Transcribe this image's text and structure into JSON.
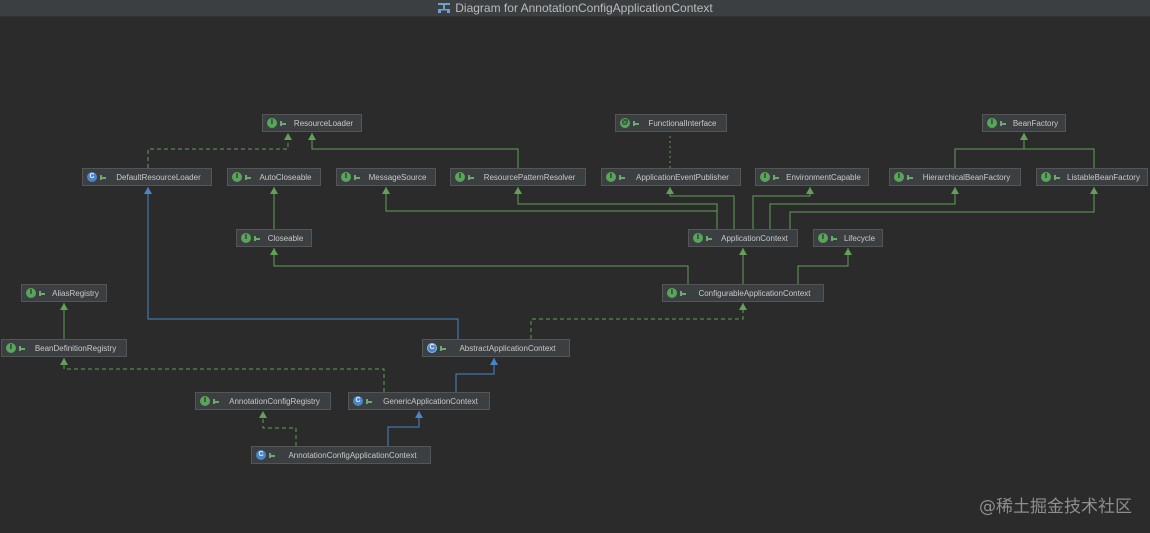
{
  "title": "Diagram for AnnotationConfigApplicationContext",
  "colors": {
    "background": "#2b2b2b",
    "node_fill": "#3c3f41",
    "interface_icon": "#58a55c",
    "class_icon": "#4a86c7",
    "extends_edge": "#4a86c7",
    "implements_edge": "#62a157"
  },
  "nodes": [
    {
      "id": "ResourceLoader",
      "label": "ResourceLoader",
      "kind": "interface"
    },
    {
      "id": "FunctionalInterface",
      "label": "FunctionalInterface",
      "kind": "annotation"
    },
    {
      "id": "BeanFactory",
      "label": "BeanFactory",
      "kind": "interface"
    },
    {
      "id": "DefaultResourceLoader",
      "label": "DefaultResourceLoader",
      "kind": "class"
    },
    {
      "id": "AutoCloseable",
      "label": "AutoCloseable",
      "kind": "interface"
    },
    {
      "id": "MessageSource",
      "label": "MessageSource",
      "kind": "interface"
    },
    {
      "id": "ResourcePatternResolver",
      "label": "ResourcePatternResolver",
      "kind": "interface"
    },
    {
      "id": "ApplicationEventPublisher",
      "label": "ApplicationEventPublisher",
      "kind": "interface"
    },
    {
      "id": "EnvironmentCapable",
      "label": "EnvironmentCapable",
      "kind": "interface"
    },
    {
      "id": "HierarchicalBeanFactory",
      "label": "HierarchicalBeanFactory",
      "kind": "interface"
    },
    {
      "id": "ListableBeanFactory",
      "label": "ListableBeanFactory",
      "kind": "interface"
    },
    {
      "id": "Closeable",
      "label": "Closeable",
      "kind": "interface"
    },
    {
      "id": "ApplicationContext",
      "label": "ApplicationContext",
      "kind": "interface"
    },
    {
      "id": "Lifecycle",
      "label": "Lifecycle",
      "kind": "interface"
    },
    {
      "id": "AliasRegistry",
      "label": "AliasRegistry",
      "kind": "interface"
    },
    {
      "id": "ConfigurableApplicationContext",
      "label": "ConfigurableApplicationContext",
      "kind": "interface"
    },
    {
      "id": "BeanDefinitionRegistry",
      "label": "BeanDefinitionRegistry",
      "kind": "interface"
    },
    {
      "id": "AbstractApplicationContext",
      "label": "AbstractApplicationContext",
      "kind": "abstract"
    },
    {
      "id": "AnnotationConfigRegistry",
      "label": "AnnotationConfigRegistry",
      "kind": "interface"
    },
    {
      "id": "GenericApplicationContext",
      "label": "GenericApplicationContext",
      "kind": "class"
    },
    {
      "id": "AnnotationConfigApplicationContext",
      "label": "AnnotationConfigApplicationContext",
      "kind": "class"
    }
  ],
  "edges": [
    {
      "from": "DefaultResourceLoader",
      "to": "ResourceLoader",
      "type": "implements"
    },
    {
      "from": "ResourcePatternResolver",
      "to": "ResourceLoader",
      "type": "extends-interface"
    },
    {
      "from": "ApplicationEventPublisher",
      "to": "FunctionalInterface",
      "type": "annotated"
    },
    {
      "from": "HierarchicalBeanFactory",
      "to": "BeanFactory",
      "type": "extends-interface"
    },
    {
      "from": "ListableBeanFactory",
      "to": "BeanFactory",
      "type": "extends-interface"
    },
    {
      "from": "Closeable",
      "to": "AutoCloseable",
      "type": "extends-interface"
    },
    {
      "from": "ApplicationContext",
      "to": "MessageSource",
      "type": "extends-interface"
    },
    {
      "from": "ApplicationContext",
      "to": "ResourcePatternResolver",
      "type": "extends-interface"
    },
    {
      "from": "ApplicationContext",
      "to": "ApplicationEventPublisher",
      "type": "extends-interface"
    },
    {
      "from": "ApplicationContext",
      "to": "EnvironmentCapable",
      "type": "extends-interface"
    },
    {
      "from": "ApplicationContext",
      "to": "HierarchicalBeanFactory",
      "type": "extends-interface"
    },
    {
      "from": "ApplicationContext",
      "to": "ListableBeanFactory",
      "type": "extends-interface"
    },
    {
      "from": "ConfigurableApplicationContext",
      "to": "ApplicationContext",
      "type": "extends-interface"
    },
    {
      "from": "ConfigurableApplicationContext",
      "to": "Lifecycle",
      "type": "extends-interface"
    },
    {
      "from": "ConfigurableApplicationContext",
      "to": "Closeable",
      "type": "extends-interface"
    },
    {
      "from": "BeanDefinitionRegistry",
      "to": "AliasRegistry",
      "type": "extends-interface"
    },
    {
      "from": "AbstractApplicationContext",
      "to": "DefaultResourceLoader",
      "type": "extends"
    },
    {
      "from": "AbstractApplicationContext",
      "to": "ConfigurableApplicationContext",
      "type": "implements"
    },
    {
      "from": "GenericApplicationContext",
      "to": "AbstractApplicationContext",
      "type": "extends"
    },
    {
      "from": "GenericApplicationContext",
      "to": "BeanDefinitionRegistry",
      "type": "implements"
    },
    {
      "from": "AnnotationConfigApplicationContext",
      "to": "GenericApplicationContext",
      "type": "extends"
    },
    {
      "from": "AnnotationConfigApplicationContext",
      "to": "AnnotationConfigRegistry",
      "type": "implements"
    }
  ],
  "watermark": "@稀土掘金技术社区"
}
